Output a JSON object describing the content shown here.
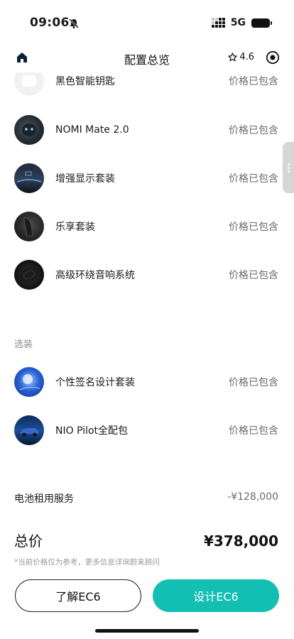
{
  "status_bar": {
    "time": "09:06",
    "network": "5G"
  },
  "nav": {
    "title": "配置总览",
    "rating": "4.6"
  },
  "included_items": [
    {
      "name": "黑色智能钥匙",
      "price": "价格已包含"
    },
    {
      "name": "NOMI Mate 2.0",
      "price": "价格已包含"
    },
    {
      "name": "增强显示套装",
      "price": "价格已包含"
    },
    {
      "name": "乐享套装",
      "price": "价格已包含"
    },
    {
      "name": "高级环绕音响系统",
      "price": "价格已包含"
    }
  ],
  "optional_section": {
    "label": "选装",
    "items": [
      {
        "name": "个性签名设计套装",
        "price": "价格已包含"
      },
      {
        "name": "NIO Pilot全配包",
        "price": "价格已包含"
      }
    ]
  },
  "battery_service": {
    "label": "电池租用服务",
    "value": "-¥128,000"
  },
  "total": {
    "label": "总价",
    "value": "¥378,000"
  },
  "disclaimer": "*当前价格仅为参考，更多信息详询蔚来顾问",
  "buttons": {
    "learn": "了解EC6",
    "design": "设计EC6"
  },
  "colors": {
    "accent": "#12bfb2",
    "text": "#1a1a1a",
    "muted": "#6b6b6b"
  }
}
